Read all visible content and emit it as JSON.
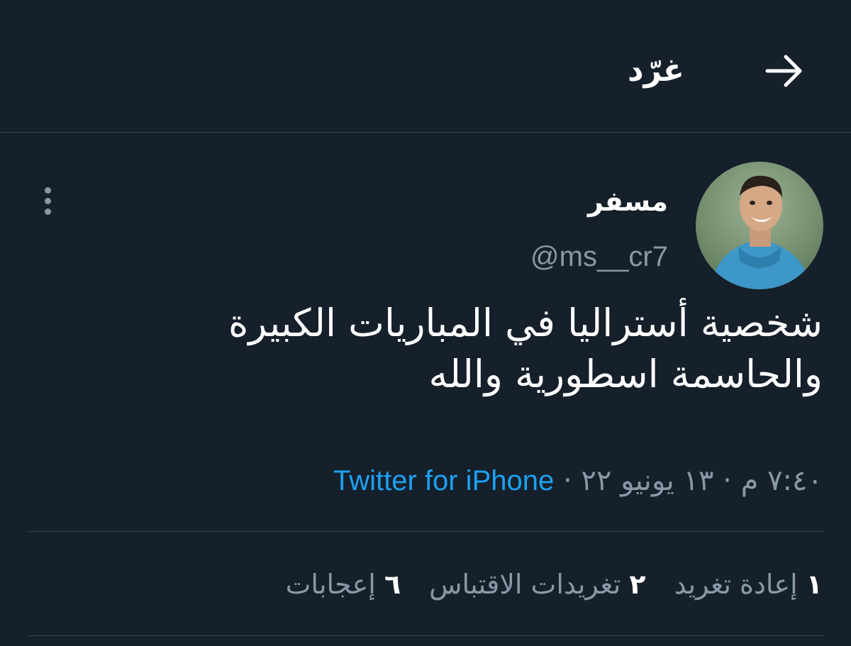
{
  "header": {
    "title": "غرّد",
    "back_icon": "arrow-right-icon"
  },
  "tweet": {
    "display_name": "مسفر",
    "handle": "@ms__cr7",
    "avatar_icon": "user-avatar",
    "more_icon": "vertical-dots-icon",
    "text_line1": "شخصية أستراليا في المباريات الكبيرة",
    "text_line2": "والحاسمة اسطورية والله",
    "time": "٧:٤٠ م",
    "separator": "·",
    "date": "١٣ يونيو ٢٢",
    "source": "Twitter for iPhone"
  },
  "stats": [
    {
      "count": "١",
      "label": "إعادة تغريد"
    },
    {
      "count": "٢",
      "label": "تغريدات الاقتباس"
    },
    {
      "count": "٦",
      "label": "إعجابات"
    }
  ],
  "colors": {
    "background": "#15202b",
    "divider": "#38444d",
    "muted_text": "#8899a6",
    "link": "#1da1f2"
  }
}
